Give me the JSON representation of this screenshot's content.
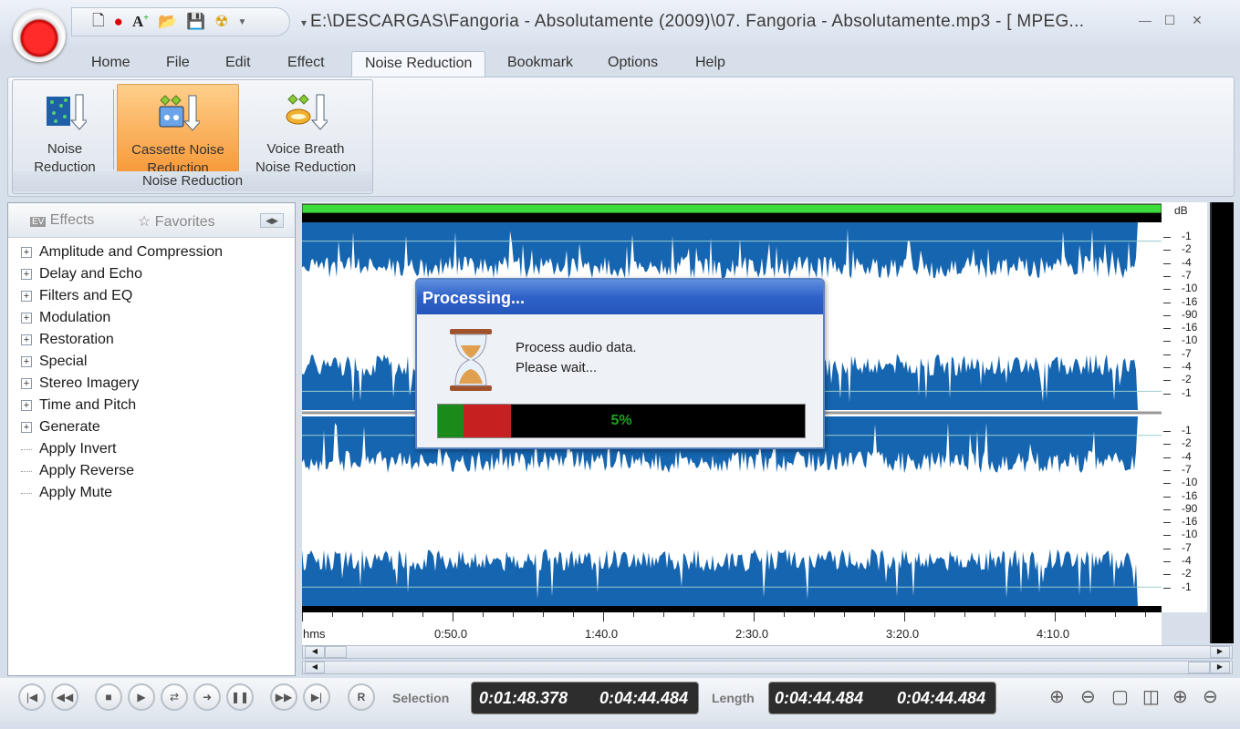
{
  "window": {
    "title": "E:\\DESCARGAS\\Fangoria - Absolutamente (2009)\\07. Fangoria - Absolutamente.mp3 - [ MPEG...",
    "controls": [
      "minimize",
      "maximize",
      "close"
    ]
  },
  "quick_access": [
    "new-file-icon",
    "record-icon",
    "add-text-icon",
    "open-folder-icon",
    "save-icon",
    "radiation-icon",
    "dropdown-icon"
  ],
  "menu_tabs": [
    "Home",
    "File",
    "Edit",
    "Effect",
    "Noise Reduction",
    "Bookmark",
    "Options",
    "Help"
  ],
  "active_tab": "Noise Reduction",
  "ribbon": {
    "group_label": "Noise Reduction",
    "buttons": [
      {
        "label1": "Noise",
        "label2": "Reduction"
      },
      {
        "label1": "Cassette Noise",
        "label2": "Reduction",
        "selected": true
      },
      {
        "label1": "Voice Breath",
        "label2": "Noise Reduction"
      }
    ]
  },
  "left_panel": {
    "tab_effects": "Effects",
    "tab_favorites": "Favorites",
    "tree": [
      {
        "label": "Amplitude and Compression",
        "expandable": true
      },
      {
        "label": "Delay and Echo",
        "expandable": true
      },
      {
        "label": "Filters and EQ",
        "expandable": true
      },
      {
        "label": "Modulation",
        "expandable": true
      },
      {
        "label": "Restoration",
        "expandable": true
      },
      {
        "label": "Special",
        "expandable": true
      },
      {
        "label": "Stereo Imagery",
        "expandable": true
      },
      {
        "label": "Time and Pitch",
        "expandable": true
      },
      {
        "label": "Generate",
        "expandable": true
      },
      {
        "label": "Apply Invert",
        "expandable": false
      },
      {
        "label": "Apply Reverse",
        "expandable": false
      },
      {
        "label": "Apply Mute",
        "expandable": false
      }
    ]
  },
  "db_scale": {
    "unit": "dB",
    "ticks": [
      "-1",
      "-2",
      "-4",
      "-7",
      "-10",
      "-16",
      "-90",
      "-16",
      "-10",
      "-7",
      "-4",
      "-2",
      "-1"
    ]
  },
  "ruler": {
    "unit": "hms",
    "labels": [
      "0:50.0",
      "1:40.0",
      "2:30.0",
      "3:20.0",
      "4:10.0"
    ]
  },
  "colors": {
    "waveform": "#1565b0",
    "progress_text": "#1fa21f",
    "dialog_title": "#2f62c8"
  },
  "dialog": {
    "title": "Processing...",
    "line1": "Process audio data.",
    "line2": "Please wait...",
    "progress_percent": 5,
    "progress_text": "5%"
  },
  "transport": {
    "buttons": [
      "skip-start",
      "rewind",
      "stop",
      "play",
      "loop",
      "play-selection",
      "pause",
      "fast-forward",
      "skip-end",
      "record"
    ],
    "record_label": "R"
  },
  "selection": {
    "label": "Selection",
    "start": "0:01:48.378",
    "end": "0:04:44.484"
  },
  "length": {
    "label": "Length",
    "value1": "0:04:44.484",
    "value2": "0:04:44.484"
  },
  "zoom_tools": [
    "zoom-in-icon",
    "zoom-out-icon",
    "zoom-fit-icon",
    "zoom-selection-icon",
    "zoom-in-vertical-icon",
    "zoom-out-vertical-icon"
  ]
}
